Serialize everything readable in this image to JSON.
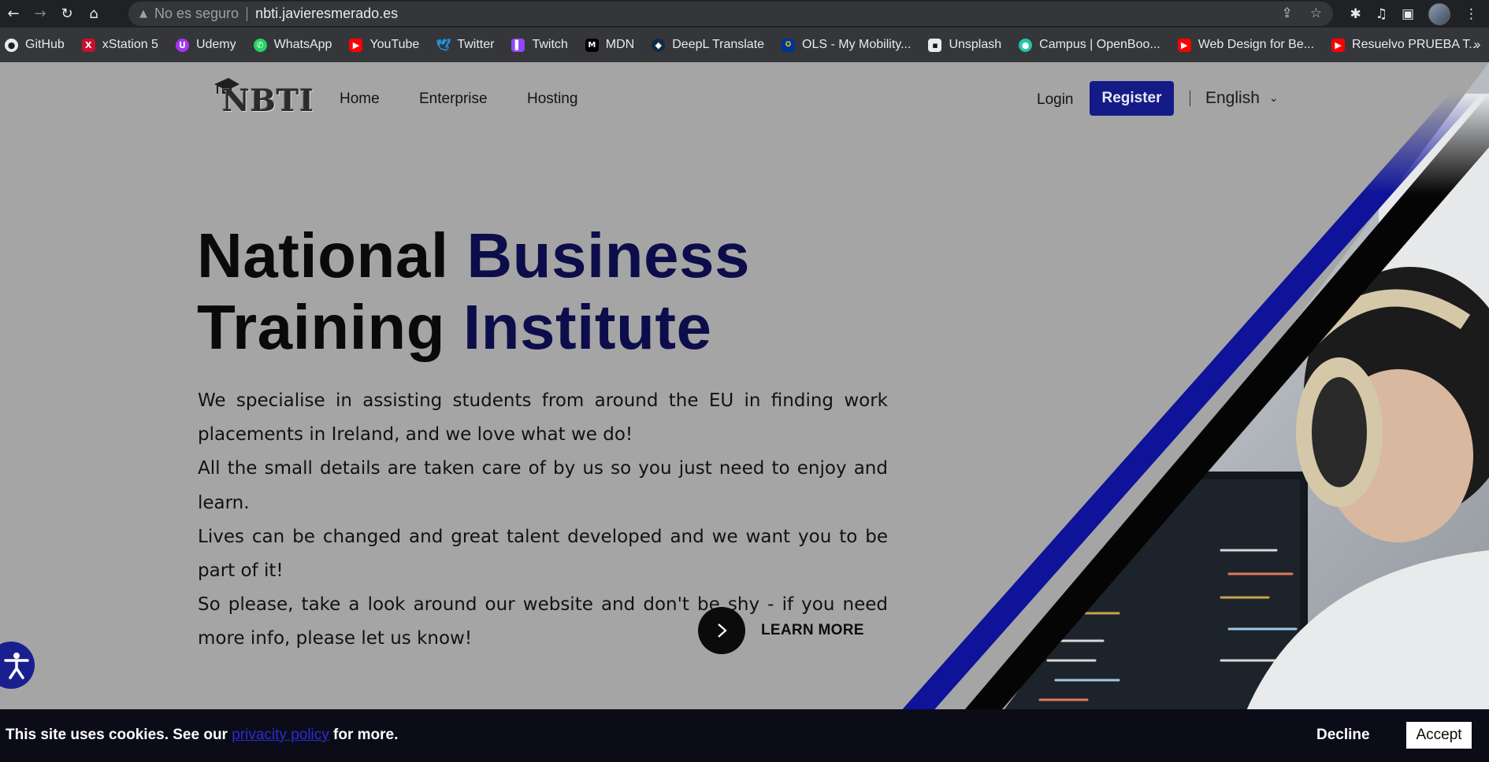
{
  "browser": {
    "address_warning": "No es seguro",
    "url": "nbti.javieresmerado.es",
    "bookmarks": [
      {
        "label": "GitHub",
        "icon": "github-icon",
        "color": "#e8eaed"
      },
      {
        "label": "xStation 5",
        "icon": "xstation-icon",
        "color": "#c8102e"
      },
      {
        "label": "Udemy",
        "icon": "udemy-icon",
        "color": "#a435f0"
      },
      {
        "label": "WhatsApp",
        "icon": "whatsapp-icon",
        "color": "#25d366"
      },
      {
        "label": "YouTube",
        "icon": "youtube-icon",
        "color": "#ff0000"
      },
      {
        "label": "Twitter",
        "icon": "twitter-icon",
        "color": "#1d9bf0"
      },
      {
        "label": "Twitch",
        "icon": "twitch-icon",
        "color": "#9146ff"
      },
      {
        "label": "MDN",
        "icon": "mdn-icon",
        "color": "#000000"
      },
      {
        "label": "DeepL Translate",
        "icon": "deepl-icon",
        "color": "#0f2b46"
      },
      {
        "label": "OLS - My Mobility...",
        "icon": "eu-flag-icon",
        "color": "#003399"
      },
      {
        "label": "Unsplash",
        "icon": "unsplash-icon",
        "color": "#111111"
      },
      {
        "label": "Campus | OpenBoo...",
        "icon": "openbootcamp-icon",
        "color": "#21c7a8"
      },
      {
        "label": "Web Design for Be...",
        "icon": "youtube-icon",
        "color": "#ff0000"
      },
      {
        "label": "Resuelvo PRUEBA T...",
        "icon": "youtube-icon",
        "color": "#ff0000"
      }
    ],
    "more_bookmarks": "»"
  },
  "site": {
    "logo_text": "NBTI",
    "nav": [
      {
        "label": "Home"
      },
      {
        "label": "Enterprise"
      },
      {
        "label": "Hosting"
      }
    ],
    "login_label": "Login",
    "register_label": "Register",
    "language": "English",
    "accent_color": "#141a86"
  },
  "hero": {
    "title_line1_a": "National ",
    "title_line1_b": "Business",
    "title_line2_a": "Training ",
    "title_line2_b": "Institute",
    "paragraph1": "We specialise in assisting students from around the EU in finding work placements in Ireland, and we love what we do!",
    "paragraph2": "All the small details are taken care of by us so you just need to enjoy and learn.",
    "paragraph3": "Lives can be changed and great talent developed and we want you to be part of it!",
    "paragraph4": "So please, take a look around our website and don't be shy - if you need more info, please let us know!",
    "cta_label": "LEARN MORE"
  },
  "cookies": {
    "text_before": "This site uses cookies. See our ",
    "link_text": "privacity policy",
    "text_after": " for more.",
    "decline_label": "Decline",
    "accept_label": "Accept"
  }
}
